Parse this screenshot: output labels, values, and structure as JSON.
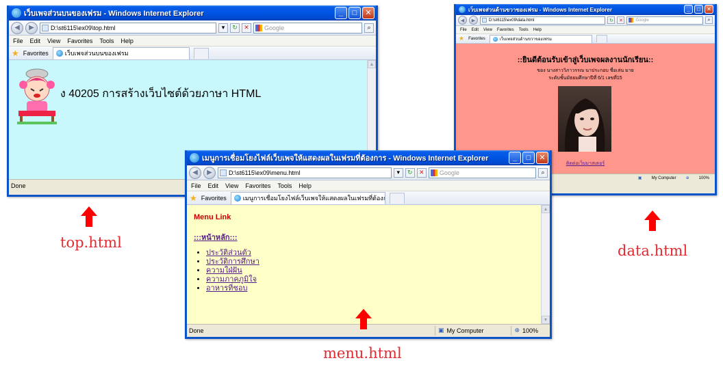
{
  "top_window": {
    "title": "เว็บเพจส่วนบนของเฟรม - Windows Internet Explorer",
    "url": "D:\\st6115\\ex09\\top.html",
    "search_placeholder": "Google",
    "menu": [
      "File",
      "Edit",
      "View",
      "Favorites",
      "Tools",
      "Help"
    ],
    "favorites_label": "Favorites",
    "tab_label": "เว็บเพจส่วนบนของเฟรม",
    "heading": "ง 40205 การสร้างเว็บไซต์ด้วยภาษา HTML",
    "status_text": "Done",
    "bg_color": "#c8f8fc"
  },
  "data_window": {
    "title": "เว็บเพจส่วนด้านขวาของเฟรม - Windows Internet Explorer",
    "url": "D:\\st6115\\ex09\\data.html",
    "search_placeholder": "Google",
    "menu": [
      "File",
      "Edit",
      "View",
      "Favorites",
      "Tools",
      "Help"
    ],
    "favorites_label": "Favorites",
    "tab_label": "เว็บเพจส่วนด้านขวาของเฟรม",
    "heading": "::ยินดีต้อนรับเข้าสู่เว็บเพจผลงานนักเรียน::",
    "owner_line": "ของ นางสาววิภาวรรณ นาประกอบ ชื่อเล่น มาย",
    "class_line": "ระดับชั้นมัธยมศึกษาปีที่ 6/1 เลขที่15",
    "contact_link": "ติดต่อเว็บมาสเตอร์",
    "status_zone": "My Computer",
    "zoom": "100%",
    "bg_color": "#ff968c"
  },
  "menu_window": {
    "title": "เมนูการเชื่อมโยงไฟล์เว็บเพจให้แสดงผลในเฟรมที่ต้องการ - Windows Internet Explorer",
    "url": "D:\\st6115\\ex09\\menu.html",
    "search_placeholder": "Google",
    "menu": [
      "File",
      "Edit",
      "View",
      "Favorites",
      "Tools",
      "Help"
    ],
    "favorites_label": "Favorites",
    "tab_label": "เมนูการเชื่อมโยงไฟล์เว็บเพจให้แสดงผลในเฟรมที่ต้องการ",
    "menu_heading": "Menu Link",
    "home_link": ":::หน้าหลัก:::",
    "links": [
      "ประวัติส่วนตัว",
      "ประวัติการศึกษา",
      "ความใฝ่ฝัน",
      "ความภาคภูมิใจ",
      "อาหารที่ชอบ"
    ],
    "status_text": "Done",
    "status_zone": "My Computer",
    "zoom": "100%",
    "bg_color": "#ffffc8"
  },
  "captions": {
    "top": "top.html",
    "menu": "menu.html",
    "data": "data.html"
  },
  "colors": {
    "caption_red": "#e2292f",
    "heading_red": "#cc0000",
    "link_purple": "#551a8b"
  }
}
